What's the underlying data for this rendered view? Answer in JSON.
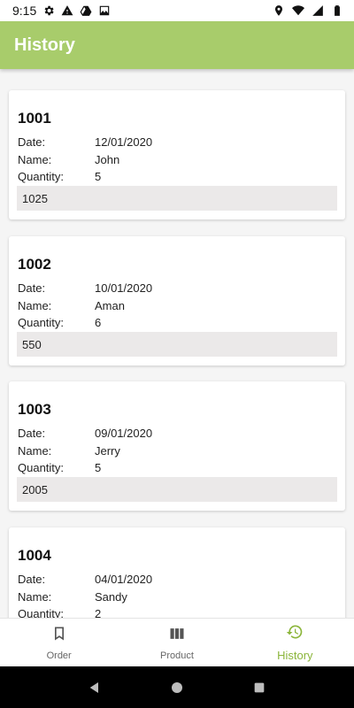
{
  "status_bar": {
    "time": "9:15",
    "left_icons": [
      "gear-icon",
      "warning-icon",
      "drive-icon",
      "photo-icon"
    ],
    "right_icons": [
      "location-icon",
      "wifi-icon",
      "signal-icon",
      "battery-icon"
    ]
  },
  "app_bar": {
    "title": "History"
  },
  "labels": {
    "date": "Date:",
    "name": "Name:",
    "quantity": "Quantity:"
  },
  "orders": [
    {
      "id": "1001",
      "date": "12/01/2020",
      "name": "John",
      "quantity": "5",
      "total": "1025"
    },
    {
      "id": "1002",
      "date": "10/01/2020",
      "name": "Aman",
      "quantity": "6",
      "total": "550"
    },
    {
      "id": "1003",
      "date": "09/01/2020",
      "name": "Jerry",
      "quantity": "5",
      "total": "2005"
    },
    {
      "id": "1004",
      "date": "04/01/2020",
      "name": "Sandy",
      "quantity": "2",
      "total": ""
    }
  ],
  "bottom_nav": [
    {
      "label": "Order",
      "icon": "bookmark-icon",
      "active": false
    },
    {
      "label": "Product",
      "icon": "columns-icon",
      "active": false
    },
    {
      "label": "History",
      "icon": "history-icon",
      "active": true
    }
  ],
  "colors": {
    "primary": "#a8cc6b",
    "active_nav": "#8bb53a",
    "total_bg": "#ebe9e9"
  }
}
